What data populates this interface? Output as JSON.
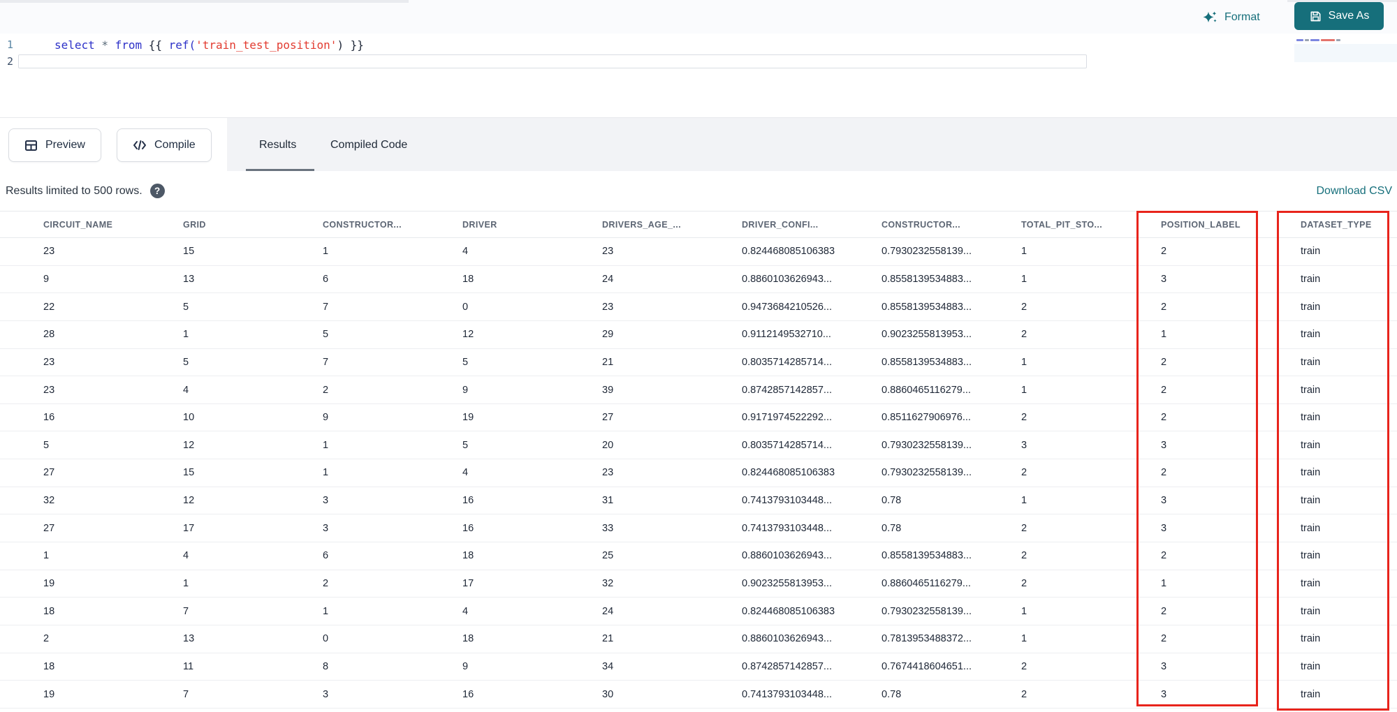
{
  "code_editor": {
    "format_label": "Format",
    "save_as_label": "Save As",
    "line1": {
      "number": "1",
      "kw_select": "select",
      "star": "*",
      "kw_from": "from",
      "brace_open": "{{",
      "fn_ref": "ref(",
      "string_arg": "'train_test_position'",
      "paren_close": ")",
      "brace_close": "}}"
    },
    "line2": {
      "number": "2"
    }
  },
  "toolbar": {
    "preview_label": "Preview",
    "compile_label": "Compile"
  },
  "tabs": {
    "results": "Results",
    "compiled_code": "Compiled Code"
  },
  "results_bar": {
    "info": "Results limited to 500 rows.",
    "help_icon_glyph": "?",
    "download_label": "Download CSV"
  },
  "table": {
    "columns": [
      "CIRCUIT_NAME",
      "GRID",
      "CONSTRUCTOR...",
      "DRIVER",
      "DRIVERS_AGE_...",
      "DRIVER_CONFI...",
      "CONSTRUCTOR...",
      "TOTAL_PIT_STO...",
      "POSITION_LABEL",
      "DATASET_TYPE"
    ],
    "rows": [
      [
        "23",
        "15",
        "1",
        "4",
        "23",
        "0.824468085106383",
        "0.7930232558139...",
        "1",
        "2",
        "train"
      ],
      [
        "9",
        "13",
        "6",
        "18",
        "24",
        "0.8860103626943...",
        "0.8558139534883...",
        "1",
        "3",
        "train"
      ],
      [
        "22",
        "5",
        "7",
        "0",
        "23",
        "0.9473684210526...",
        "0.8558139534883...",
        "2",
        "2",
        "train"
      ],
      [
        "28",
        "1",
        "5",
        "12",
        "29",
        "0.9112149532710...",
        "0.9023255813953...",
        "2",
        "1",
        "train"
      ],
      [
        "23",
        "5",
        "7",
        "5",
        "21",
        "0.8035714285714...",
        "0.8558139534883...",
        "1",
        "2",
        "train"
      ],
      [
        "23",
        "4",
        "2",
        "9",
        "39",
        "0.8742857142857...",
        "0.8860465116279...",
        "1",
        "2",
        "train"
      ],
      [
        "16",
        "10",
        "9",
        "19",
        "27",
        "0.9171974522292...",
        "0.8511627906976...",
        "2",
        "2",
        "train"
      ],
      [
        "5",
        "12",
        "1",
        "5",
        "20",
        "0.8035714285714...",
        "0.7930232558139...",
        "3",
        "3",
        "train"
      ],
      [
        "27",
        "15",
        "1",
        "4",
        "23",
        "0.824468085106383",
        "0.7930232558139...",
        "2",
        "2",
        "train"
      ],
      [
        "32",
        "12",
        "3",
        "16",
        "31",
        "0.7413793103448...",
        "0.78",
        "1",
        "3",
        "train"
      ],
      [
        "27",
        "17",
        "3",
        "16",
        "33",
        "0.7413793103448...",
        "0.78",
        "2",
        "3",
        "train"
      ],
      [
        "1",
        "4",
        "6",
        "18",
        "25",
        "0.8860103626943...",
        "0.8558139534883...",
        "2",
        "2",
        "train"
      ],
      [
        "19",
        "1",
        "2",
        "17",
        "32",
        "0.9023255813953...",
        "0.8860465116279...",
        "2",
        "1",
        "train"
      ],
      [
        "18",
        "7",
        "1",
        "4",
        "24",
        "0.824468085106383",
        "0.7930232558139...",
        "1",
        "2",
        "train"
      ],
      [
        "2",
        "13",
        "0",
        "18",
        "21",
        "0.8860103626943...",
        "0.7813953488372...",
        "1",
        "2",
        "train"
      ],
      [
        "18",
        "11",
        "8",
        "9",
        "34",
        "0.8742857142857...",
        "0.7674418604651...",
        "2",
        "3",
        "train"
      ],
      [
        "19",
        "7",
        "3",
        "16",
        "30",
        "0.7413793103448...",
        "0.78",
        "2",
        "3",
        "train"
      ]
    ],
    "highlighted_columns": [
      "POSITION_LABEL",
      "DATASET_TYPE"
    ]
  },
  "colors": {
    "accent_teal": "#166f7b",
    "highlight_red": "#e8241c"
  }
}
